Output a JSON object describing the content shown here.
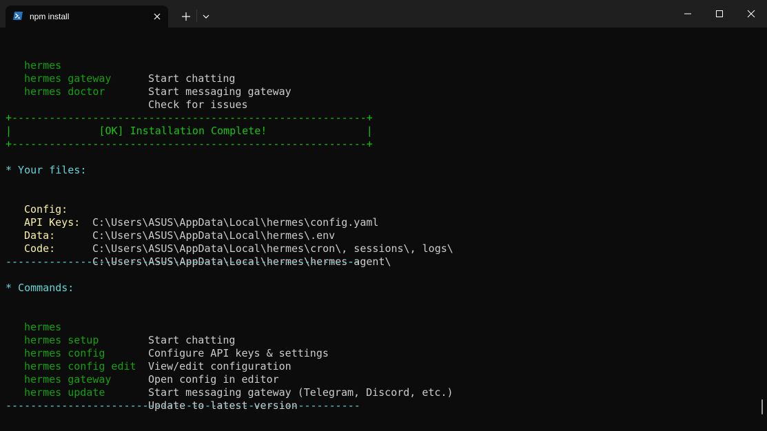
{
  "tab": {
    "title": "npm install",
    "icon": "powershell-icon"
  },
  "titlebar": {
    "new_tab_glyph": "+",
    "colors": {
      "bar": "#1f1f1f",
      "tab": "#0c0c0c"
    }
  },
  "colors": {
    "command": "#13a10e",
    "banner": "#16c60c",
    "label": "#f9f1a5",
    "heading": "#61d6d6",
    "text": "#cccccc"
  },
  "top_commands": [
    {
      "cmd": "hermes",
      "desc": "Start chatting"
    },
    {
      "cmd": "hermes gateway",
      "desc": "Start messaging gateway"
    },
    {
      "cmd": "hermes doctor",
      "desc": "Check for issues"
    }
  ],
  "banner": {
    "top": "+---------------------------------------------------------+",
    "middle": "|              [OK] Installation Complete!                |",
    "bottom": "+---------------------------------------------------------+"
  },
  "files_heading": "* Your files:",
  "files": [
    {
      "label": "Config:",
      "path": "C:\\Users\\ASUS\\AppData\\Local\\hermes\\config.yaml"
    },
    {
      "label": "API Keys:",
      "path": "C:\\Users\\ASUS\\AppData\\Local\\hermes\\.env"
    },
    {
      "label": "Data:",
      "path": "C:\\Users\\ASUS\\AppData\\Local\\hermes\\cron\\, sessions\\, logs\\"
    },
    {
      "label": "Code:",
      "path": "C:\\Users\\ASUS\\AppData\\Local\\hermes\\hermes-agent\\"
    }
  ],
  "divider": "---------------------------------------------------------",
  "commands_heading": "* Commands:",
  "commands": [
    {
      "cmd": "hermes",
      "desc": "Start chatting"
    },
    {
      "cmd": "hermes setup",
      "desc": "Configure API keys & settings"
    },
    {
      "cmd": "hermes config",
      "desc": "View/edit configuration"
    },
    {
      "cmd": "hermes config edit",
      "desc": "Open config in editor"
    },
    {
      "cmd": "hermes gateway",
      "desc": "Start messaging gateway (Telegram, Discord, etc.)"
    },
    {
      "cmd": "hermes update",
      "desc": "Update to latest version"
    }
  ]
}
